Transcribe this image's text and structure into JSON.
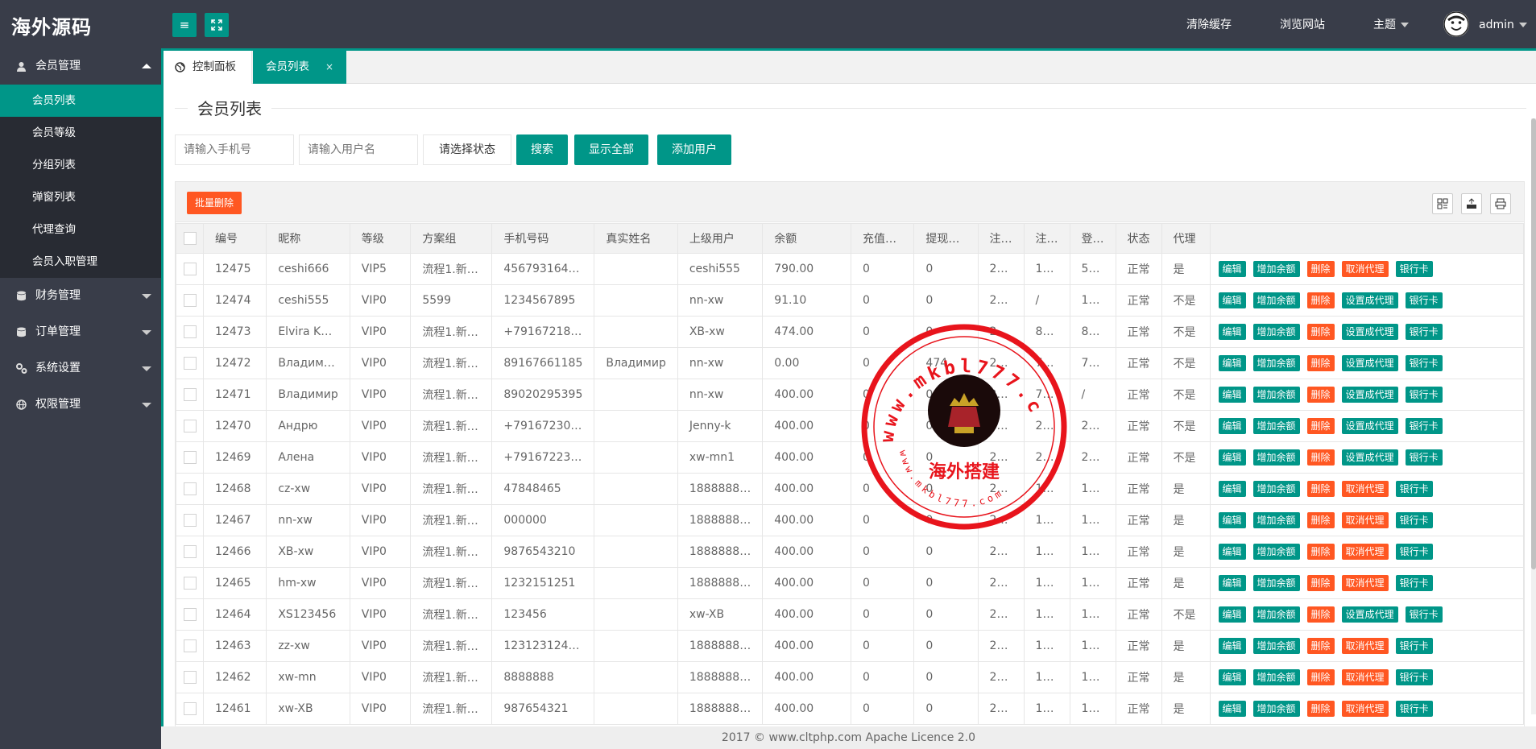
{
  "header": {
    "logo": "海外源码",
    "nav": {
      "clear_cache": "清除缓存",
      "browse_site": "浏览网站",
      "theme": "主题",
      "user": "admin"
    }
  },
  "sidebar": {
    "groups": [
      {
        "label": "会员管理",
        "icon": "user-icon"
      },
      {
        "label": "财务管理",
        "icon": "database-icon"
      },
      {
        "label": "订单管理",
        "icon": "database-icon"
      },
      {
        "label": "系统设置",
        "icon": "settings-icon"
      },
      {
        "label": "权限管理",
        "icon": "globe-icon"
      }
    ],
    "sub_items": [
      "会员列表",
      "会员等级",
      "分组列表",
      "弹窗列表",
      "代理查询",
      "会员入职管理"
    ]
  },
  "tabs": {
    "home": "控制面板",
    "active": "会员列表",
    "close": "×"
  },
  "page": {
    "legend": "会员列表"
  },
  "filters": {
    "phone_placeholder": "请输入手机号",
    "name_placeholder": "请输入用户名",
    "status_select": "请选择状态",
    "search": "搜索",
    "show_all": "显示全部",
    "add_user": "添加用户"
  },
  "toolbar": {
    "batch_delete": "批量删除"
  },
  "table": {
    "headers": [
      "编号",
      "昵称",
      "等级",
      "方案组",
      "手机号码",
      "真实姓名",
      "上级用户",
      "余额",
      "充值…",
      "提现…",
      "注…",
      "注…",
      "登…",
      "状态",
      "代理"
    ],
    "rows": [
      [
        "12475",
        "ceshi666",
        "VIP5",
        "流程1.新…",
        "456793164…",
        "",
        "ceshi555",
        "790.00",
        "0",
        "0",
        "2…",
        "1…",
        "5…",
        "正常",
        "是"
      ],
      [
        "12474",
        "ceshi555",
        "VIP0",
        "5599",
        "1234567895",
        "",
        "nn-xw",
        "91.10",
        "0",
        "0",
        "2…",
        "/",
        "1…",
        "正常",
        "不是"
      ],
      [
        "12473",
        "Elvira K…",
        "VIP0",
        "流程1.新…",
        "+79167218…",
        "",
        "XB-xw",
        "474.00",
        "0",
        "0",
        "2…",
        "8…",
        "8…",
        "正常",
        "不是"
      ],
      [
        "12472",
        "Владим…",
        "VIP0",
        "流程1.新…",
        "89167661185",
        "Владимир",
        "nn-xw",
        "0.00",
        "0",
        "474",
        "2…",
        "7…",
        "7…",
        "正常",
        "不是"
      ],
      [
        "12471",
        "Владимир",
        "VIP0",
        "流程1.新…",
        "89020295395",
        "",
        "nn-xw",
        "400.00",
        "0",
        "0",
        "2…",
        "7…",
        "/",
        "正常",
        "不是"
      ],
      [
        "12470",
        "Андрю",
        "VIP0",
        "流程1.新…",
        "+79167230…",
        "",
        "Jenny-k",
        "400.00",
        "0",
        "0",
        "2…",
        "2…",
        "2…",
        "正常",
        "不是"
      ],
      [
        "12469",
        "Алена",
        "VIP0",
        "流程1.新…",
        "+79167223…",
        "",
        "xw-mn1",
        "400.00",
        "0",
        "0",
        "2…",
        "2…",
        "2…",
        "正常",
        "不是"
      ],
      [
        "12468",
        "cz-xw",
        "VIP0",
        "流程1.新…",
        "47848465",
        "",
        "1888888…",
        "400.00",
        "0",
        "0",
        "2…",
        "1…",
        "1…",
        "正常",
        "是"
      ],
      [
        "12467",
        "nn-xw",
        "VIP0",
        "流程1.新…",
        "000000",
        "",
        "1888888…",
        "400.00",
        "0",
        "0",
        "2…",
        "1…",
        "1…",
        "正常",
        "是"
      ],
      [
        "12466",
        "XB-xw",
        "VIP0",
        "流程1.新…",
        "9876543210",
        "",
        "1888888…",
        "400.00",
        "0",
        "0",
        "2…",
        "1…",
        "1…",
        "正常",
        "是"
      ],
      [
        "12465",
        "hm-xw",
        "VIP0",
        "流程1.新…",
        "1232151251",
        "",
        "1888888…",
        "400.00",
        "0",
        "0",
        "2…",
        "1…",
        "1…",
        "正常",
        "是"
      ],
      [
        "12464",
        "XS123456",
        "VIP0",
        "流程1.新…",
        "123456",
        "",
        "xw-XB",
        "400.00",
        "0",
        "0",
        "2…",
        "1…",
        "1…",
        "正常",
        "不是"
      ],
      [
        "12463",
        "zz-xw",
        "VIP0",
        "流程1.新…",
        "123123124…",
        "",
        "1888888…",
        "400.00",
        "0",
        "0",
        "2…",
        "1…",
        "1…",
        "正常",
        "是"
      ],
      [
        "12462",
        "xw-mn",
        "VIP0",
        "流程1.新…",
        "8888888",
        "",
        "1888888…",
        "400.00",
        "0",
        "0",
        "2…",
        "1…",
        "1…",
        "正常",
        "是"
      ],
      [
        "12461",
        "xw-XB",
        "VIP0",
        "流程1.新…",
        "987654321",
        "",
        "1888888…",
        "400.00",
        "0",
        "0",
        "2…",
        "1…",
        "1…",
        "正常",
        "是"
      ]
    ],
    "ops": {
      "edit": "编辑",
      "add_balance": "增加余额",
      "delete": "删除",
      "cancel_agent": "取消代理",
      "set_agent": "设置成代理",
      "bank_card": "银行卡"
    }
  },
  "watermark": {
    "url": "www.mkbl777.com",
    "name": "海外搭建"
  },
  "footer": {
    "year": "2017 ©",
    "site": "www.cltphp.com",
    "licence": "Apache Licence 2.0"
  },
  "colors": {
    "primary": "#009688",
    "danger": "#ff5722",
    "dark": "#393d49",
    "stamp": "#e8141c"
  }
}
